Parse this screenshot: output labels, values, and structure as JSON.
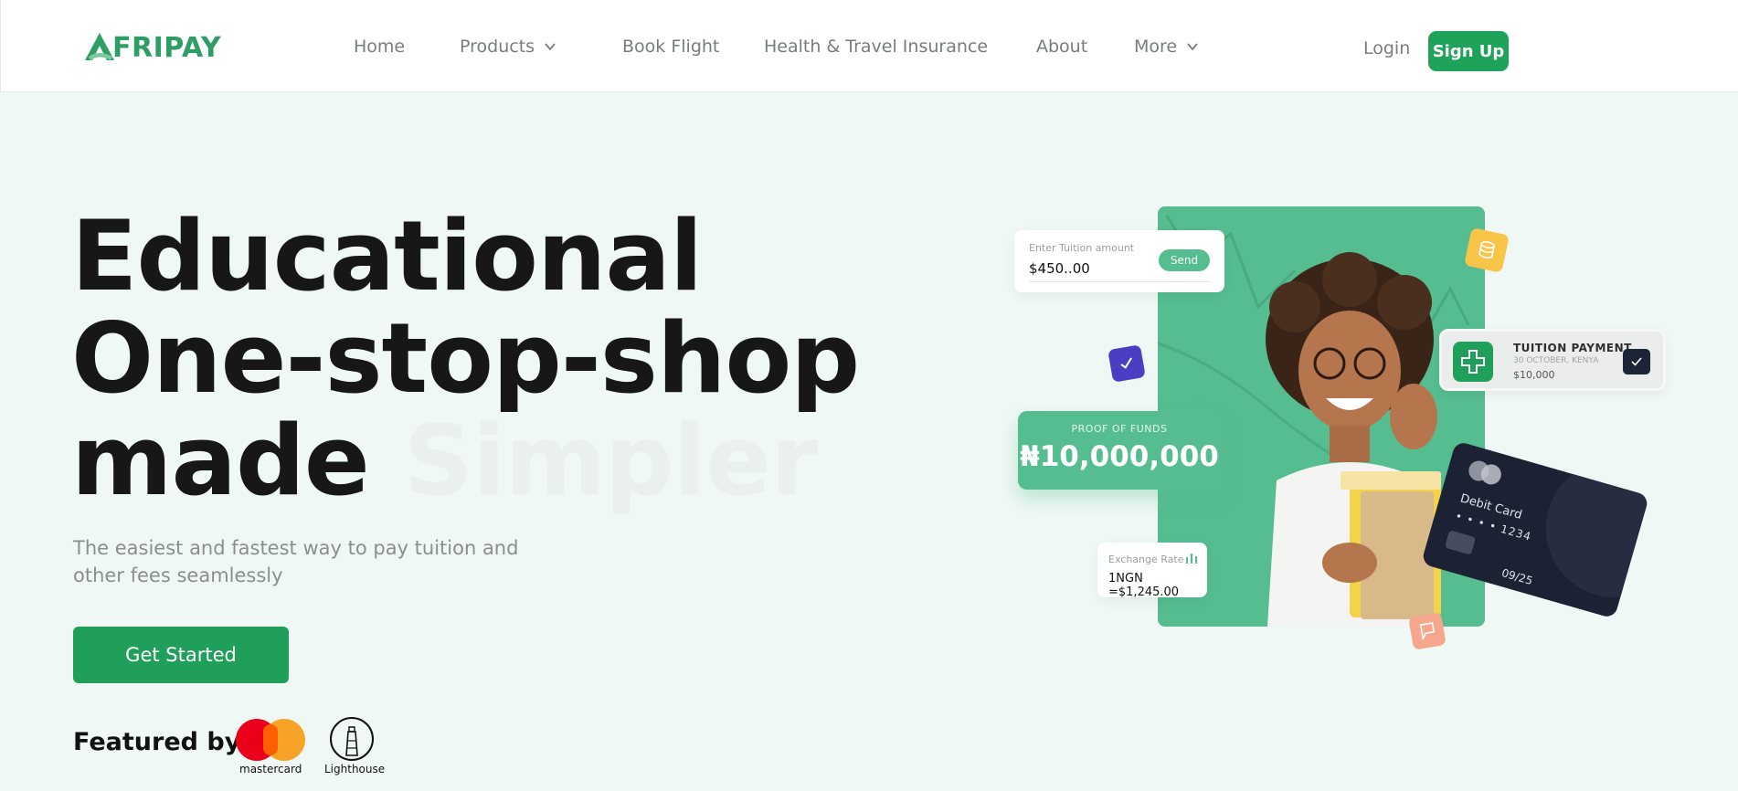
{
  "brand": {
    "name": "FRIPAY",
    "logo_icon": "afripay-a-logo-icon",
    "color": "#2f9e64"
  },
  "nav": {
    "items": [
      {
        "label": "Home"
      },
      {
        "label": "Products",
        "icon": "chevron-down-icon"
      },
      {
        "label": "Book Flight"
      },
      {
        "label": "Health & Travel Insurance"
      },
      {
        "label": "About"
      },
      {
        "label": "More",
        "icon": "chevron-down-icon"
      }
    ],
    "login": "Login",
    "signup": "Sign Up"
  },
  "hero": {
    "line1": "Educational",
    "line2": "One-stop-shop",
    "line3": "made",
    "line3_faded": "Simpler",
    "subtitle": "The easiest and fastest way to pay tuition and other fees seamlessly",
    "cta": "Get Started"
  },
  "featured": {
    "label": "Featured by",
    "partners": [
      {
        "name": "mastercard",
        "icon": "mastercard-logo-icon"
      },
      {
        "name": "Lighthouse",
        "icon": "lighthouse-logo-icon"
      }
    ]
  },
  "illustration": {
    "tuition_input": {
      "label": "Enter Tuition amount",
      "value": "$450..00",
      "button": "Send"
    },
    "proof": {
      "label": "PROOF OF FUNDS",
      "value": "₦10,000,000"
    },
    "exchange": {
      "label": "Exchange Rate",
      "value": "1NGN =$1,245.00",
      "icon": "bar-chart-icon"
    },
    "payment": {
      "title": "TUITION PAYMENT",
      "date": "30 OCTOBER, KENYA",
      "amount": "$10,000",
      "icon": "plus-icon",
      "status_icon": "check-icon"
    },
    "debit_card": {
      "label": "Debit Card",
      "number": "• • • •  1234",
      "expiry": "09/25"
    }
  },
  "colors": {
    "accent": "#1f9f5a",
    "panel_green": "#56bd91",
    "background": "#f0f8f5",
    "card_dark": "#1c2233"
  }
}
